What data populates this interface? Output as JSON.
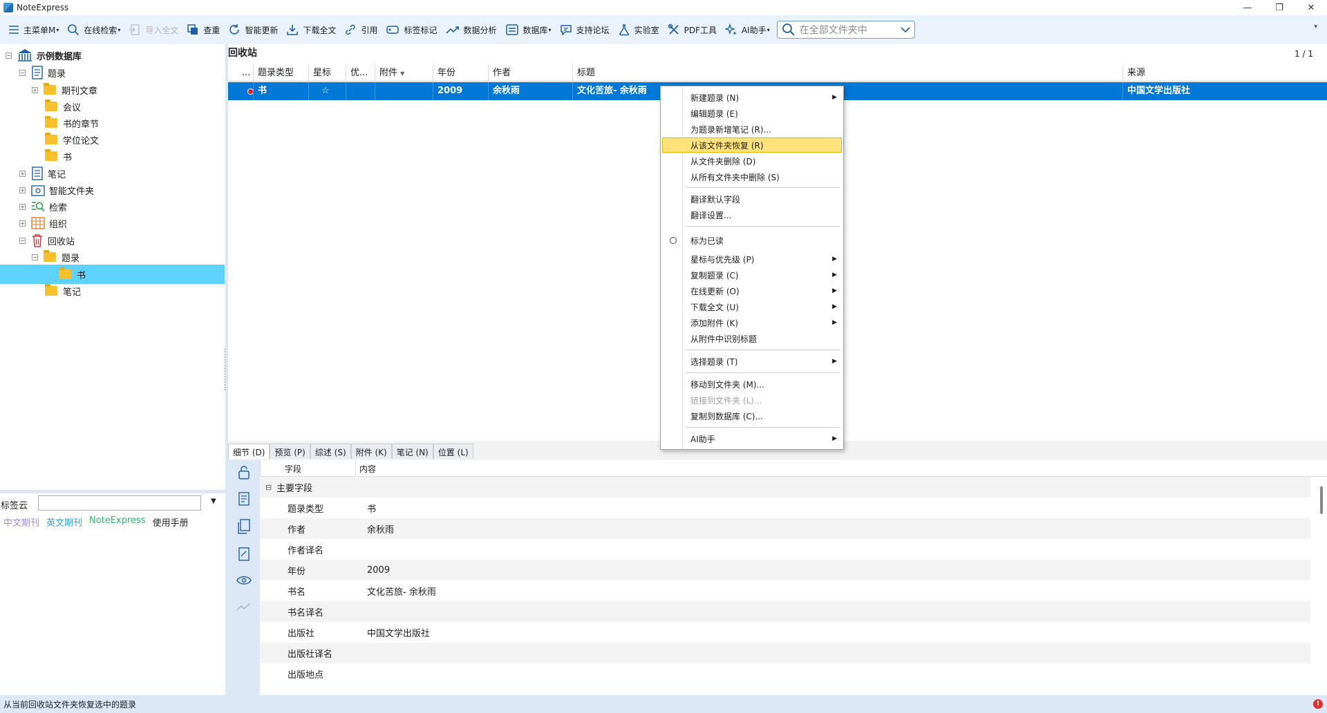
{
  "window": {
    "title": "NoteExpress",
    "minimize_glyph": "—",
    "maximize_glyph": "❐",
    "close_glyph": "✕"
  },
  "toolbar": {
    "main_menu": "主菜单M",
    "online_search": "在线检索",
    "import_fulltext": "导入全文",
    "dedup": "查重",
    "smart_update": "智能更新",
    "download_fulltext": "下载全文",
    "cite": "引用",
    "tag_mark": "标签标记",
    "data_analysis": "数据分析",
    "database": "数据库",
    "forum": "支持论坛",
    "lab": "实验室",
    "pdf_tools": "PDF工具",
    "ai_assistant": "AI助手",
    "search_placeholder": "在全部文件夹中"
  },
  "tree": {
    "root": "示例数据库",
    "records": "题录",
    "journal_articles": "期刊文章",
    "conference": "会议",
    "book_chapter": "书的章节",
    "thesis": "学位论文",
    "book": "书",
    "notes": "笔记",
    "smart_folder": "智能文件夹",
    "search": "检索",
    "organize": "组织",
    "recycle_bin": "回收站",
    "recycle_records": "题录",
    "recycle_book": "书",
    "recycle_notes": "笔记"
  },
  "tagcloud": {
    "label": "标签云",
    "tags": [
      "中文期刊",
      "英文期刊",
      "NoteExpress",
      "使用手册"
    ],
    "tag_colors": [
      "#a78ad6",
      "#2ea8d8",
      "#33b36b",
      "#222222"
    ]
  },
  "list": {
    "title": "回收站",
    "page": "1 / 1",
    "columns": {
      "dots": "...",
      "type": "题录类型",
      "star": "星标",
      "priority": "优...",
      "attachment": "附件",
      "year": "年份",
      "author": "作者",
      "title": "标题",
      "source": "来源"
    },
    "row": {
      "type": "书",
      "star": "☆",
      "year": "2009",
      "author": "余秋雨",
      "title": "文化苦旅- 余秋雨",
      "source": "中国文学出版社"
    }
  },
  "context_menu": {
    "new_record": "新建题录 (N)",
    "edit_record": "编辑题录 (E)",
    "add_note": "为题录新增笔记 (R)...",
    "restore": "从该文件夹恢复 (R)",
    "delete_from_folder": "从文件夹删除 (D)",
    "delete_from_all": "从所有文件夹中删除 (S)",
    "translate_default": "翻译默认字段",
    "translate_settings": "翻译设置...",
    "mark_read": "标为已读",
    "star_priority": "星标与优先级 (P)",
    "copy_record": "复制题录 (C)",
    "online_update": "在线更新 (O)",
    "download_fulltext": "下载全文 (U)",
    "add_attachment": "添加附件 (K)",
    "identify_title": "从附件中识别标题",
    "select_records": "选择题录 (T)",
    "move_to_folder": "移动到文件夹 (M)...",
    "link_to_folder": "链接到文件夹 (L)...",
    "copy_to_database": "复制到数据库 (C)...",
    "ai_assistant": "AI助手"
  },
  "detail": {
    "tabs": [
      "细节 (D)",
      "预览 (P)",
      "综述 (S)",
      "附件 (K)",
      "笔记 (N)",
      "位置 (L)"
    ],
    "header_field": "字段",
    "header_content": "内容",
    "group": "主要字段",
    "group_toggle": "⊟",
    "rows": [
      {
        "field": "题录类型",
        "value": "书"
      },
      {
        "field": "作者",
        "value": "余秋雨"
      },
      {
        "field": "作者译名",
        "value": ""
      },
      {
        "field": "年份",
        "value": "2009"
      },
      {
        "field": "书名",
        "value": "文化苦旅- 余秋雨"
      },
      {
        "field": "书名译名",
        "value": ""
      },
      {
        "field": "出版社",
        "value": "中国文学出版社"
      },
      {
        "field": "出版社译名",
        "value": ""
      },
      {
        "field": "出版地点",
        "value": ""
      }
    ]
  },
  "status": {
    "text": "从当前回收站文件夹恢复选中的题录",
    "warn_glyph": "!"
  },
  "colors": {
    "selection_blue": "#0078d7",
    "tree_selected": "#5fd3ff",
    "menu_highlight": "#ffe27a",
    "toolbar_bg": "#eaf3fb"
  }
}
